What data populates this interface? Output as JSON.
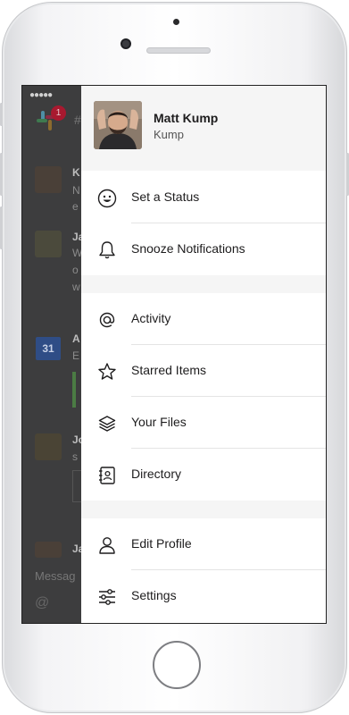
{
  "profile": {
    "name": "Matt Kump",
    "subtitle": "Kump"
  },
  "menu": {
    "status": "Set a Status",
    "snooze": "Snooze Notifications",
    "activity": "Activity",
    "starred": "Starred Items",
    "files": "Your Files",
    "directory": "Directory",
    "edit_profile": "Edit Profile",
    "settings": "Settings"
  },
  "background_app": {
    "status_bar": "●●●●●",
    "badge_count": "1",
    "channel_prefix": "#",
    "calendar_day": "31",
    "message_placeholder": "Messag",
    "sender_initials": [
      "K",
      "Ja",
      "A",
      "Jo",
      "Ja"
    ],
    "message_fragments": [
      "N",
      "e",
      "W",
      "o",
      "w",
      "E",
      "s"
    ]
  },
  "icons": {
    "status": "smiley-icon",
    "snooze": "bell-icon",
    "activity": "at-sign-icon",
    "starred": "star-icon",
    "files": "layers-icon",
    "directory": "address-book-icon",
    "edit_profile": "user-icon",
    "settings": "sliders-icon"
  },
  "colors": {
    "drawer_bg": "#ffffff",
    "header_bg": "#f5f5f5",
    "overlay_bg": "#3d3d3e",
    "badge": "#a8192f",
    "text": "#1d1c1d"
  }
}
